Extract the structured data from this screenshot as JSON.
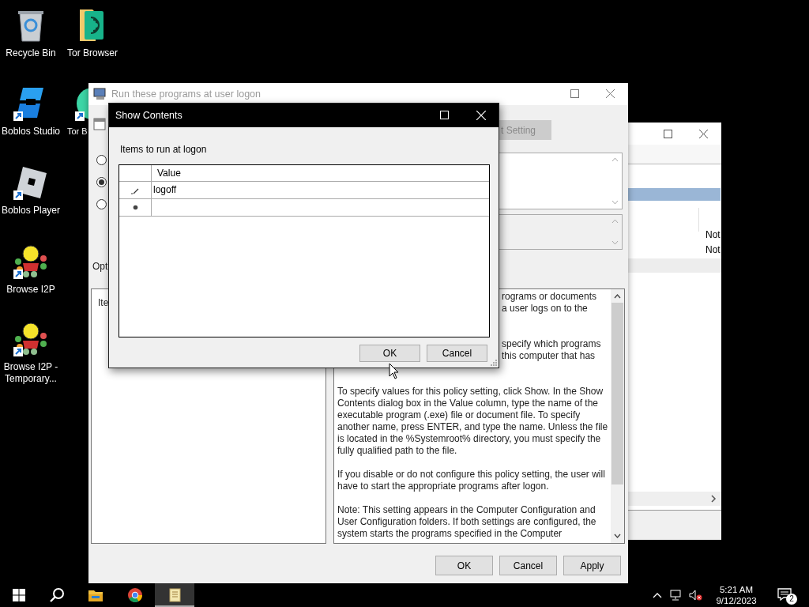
{
  "desktop_icons": [
    {
      "label": "Recycle Bin",
      "kind": "recycle",
      "shortcut": false
    },
    {
      "label": "Tor Browser",
      "kind": "tor",
      "shortcut": false
    },
    {
      "label": "Boblos Studio",
      "kind": "boblos-studio",
      "shortcut": true
    },
    {
      "label": "Tor B",
      "kind": "tor-round",
      "shortcut": true
    },
    {
      "label": "Boblos Player",
      "kind": "boblos-player",
      "shortcut": true
    },
    {
      "label": "Browse I2P",
      "kind": "i2p",
      "shortcut": true
    },
    {
      "label": "Browse I2P - Temporary...",
      "kind": "i2p",
      "shortcut": true
    }
  ],
  "background_window": {
    "status_cells": [
      "Not",
      "Not"
    ]
  },
  "policy_window": {
    "title": "Run these programs at user logon",
    "radio_options": [
      {
        "selected": false
      },
      {
        "selected": true
      },
      {
        "selected": false
      }
    ],
    "options_label": "Opt",
    "options_item": "Ite",
    "setting_button": "t Setting",
    "help_fragment_groups": [
      [
        "rograms or documents",
        "a user logs on to the"
      ],
      [
        "specify which programs",
        "this computer that has"
      ]
    ],
    "help_paragraphs": [
      "To specify values for this policy setting, click Show. In the Show Contents dialog box in the Value column, type the name of the executable program (.exe) file or document file. To specify another name, press ENTER, and type the name. Unless the file is located in the %Systemroot% directory, you must specify the fully qualified path to the file.",
      "If you disable or do not configure this policy setting, the user will have to start the appropriate programs after logon.",
      "Note: This setting appears in the Computer Configuration and User Configuration folders. If both settings are configured, the system starts the programs specified in the Computer"
    ],
    "buttons": [
      "OK",
      "Cancel",
      "Apply"
    ]
  },
  "dialog": {
    "title": "Show Contents",
    "caption": "Items to run at logon",
    "column": "Value",
    "rows": [
      {
        "kind": "editing",
        "value": "logoff"
      },
      {
        "kind": "new"
      }
    ],
    "buttons": [
      "OK",
      "Cancel"
    ]
  },
  "taskbar": {
    "apps": [
      {
        "kind": "explorer",
        "active": false
      },
      {
        "kind": "chrome",
        "active": false
      },
      {
        "kind": "notepad",
        "active": true
      }
    ],
    "time": "5:21 AM",
    "date": "9/12/2023",
    "notifications": "2"
  }
}
